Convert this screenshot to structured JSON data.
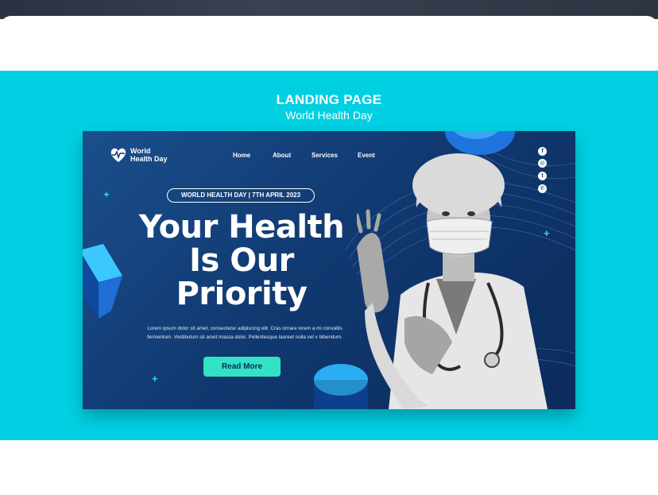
{
  "banner": {
    "title": "LANDING PAGE",
    "subtitle": "World Health Day",
    "background_color": "#00d0e2"
  },
  "hero": {
    "logo": {
      "line1": "World",
      "line2": "Health Day",
      "icon": "heart-pulse-icon"
    },
    "nav": [
      "Home",
      "About",
      "Services",
      "Event"
    ],
    "pill_text": "WORLD HEALTH DAY  |  7TH APRIL 2023",
    "headline": [
      "Your Health",
      "Is Our",
      "Priority"
    ],
    "body_lines": [
      "Lorem ipsum dolor sit amet, consectetur adipiscing elit. Cras ornare lorem a mi convallis",
      "fermentum. Vestibulum sit amet massa dolor. Pellentesque laoreet nulla vel v bibendum."
    ],
    "cta_label": "Read More",
    "social_icons": [
      "facebook-icon",
      "instagram-icon",
      "twitter-icon",
      "whatsapp-icon"
    ],
    "social_glyphs": [
      "f",
      "◎",
      "t",
      "✆"
    ],
    "colors": {
      "accent": "#33e2c4",
      "hero_bg": "#113a72"
    }
  }
}
